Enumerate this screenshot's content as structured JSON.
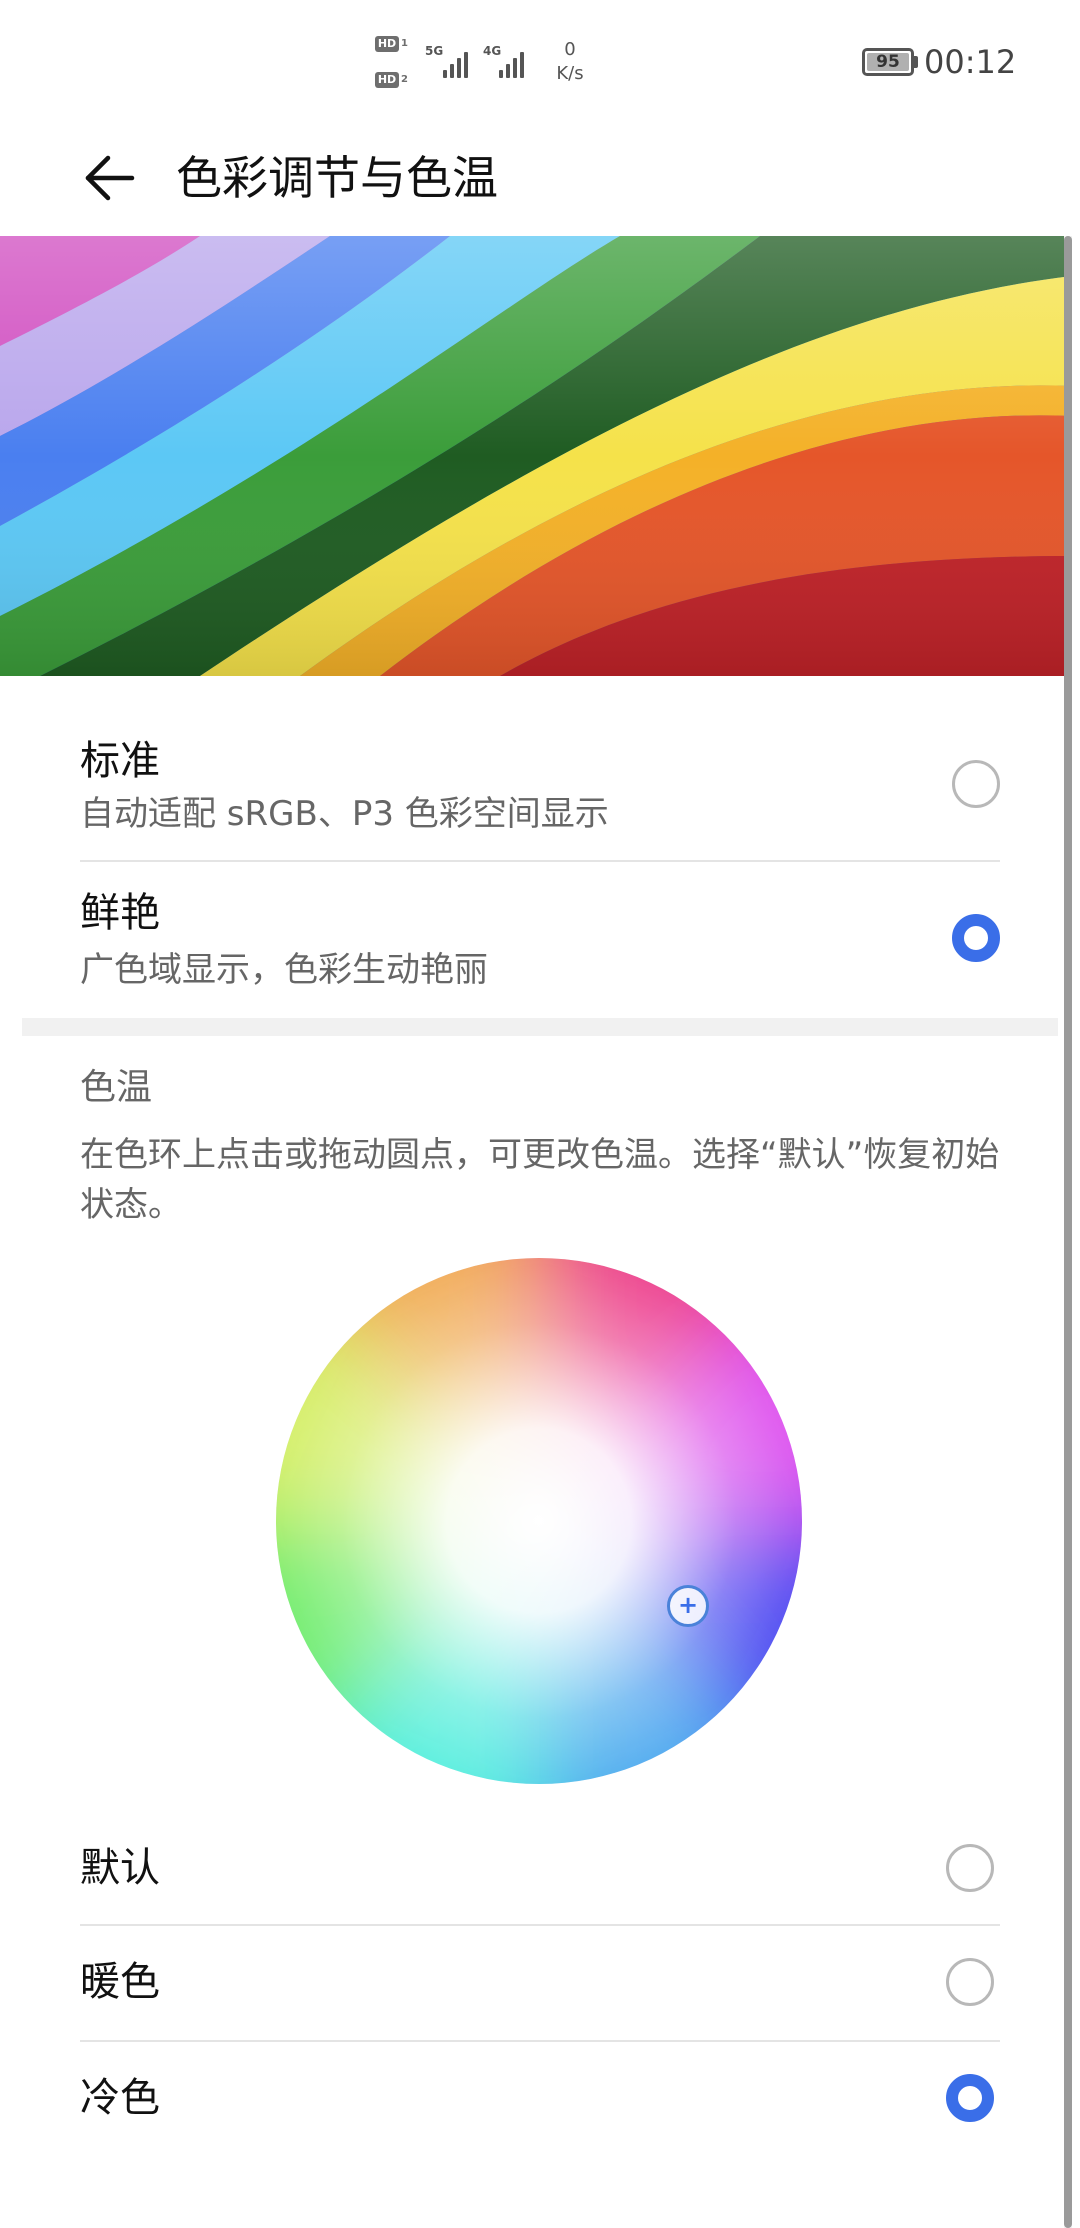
{
  "status_bar": {
    "sim1": "HD",
    "sim1_index": "1",
    "sim2": "HD",
    "sim2_index": "2",
    "net1": "5G",
    "net2": "4G",
    "speed_value": "0",
    "speed_unit": "K/s",
    "battery": "95",
    "time": "00:12"
  },
  "app_bar": {
    "title": "色彩调节与色温",
    "back_icon": "arrow-left-icon"
  },
  "modes": [
    {
      "title": "标准",
      "subtitle": "自动适配 sRGB、P3 色彩空间显示",
      "selected": false
    },
    {
      "title": "鲜艳",
      "subtitle": "广色域显示，色彩生动艳丽",
      "selected": true
    }
  ],
  "color_temp": {
    "header": "色温",
    "description": "在色环上点击或拖动圆点，可更改色温。选择“默认”恢复初始状态。",
    "handle_symbol": "+",
    "options": [
      {
        "label": "默认",
        "selected": false
      },
      {
        "label": "暖色",
        "selected": false
      },
      {
        "label": "冷色",
        "selected": true
      }
    ]
  },
  "colors": {
    "accent": "#3a6ee8",
    "divider": "#e4e4e4"
  }
}
